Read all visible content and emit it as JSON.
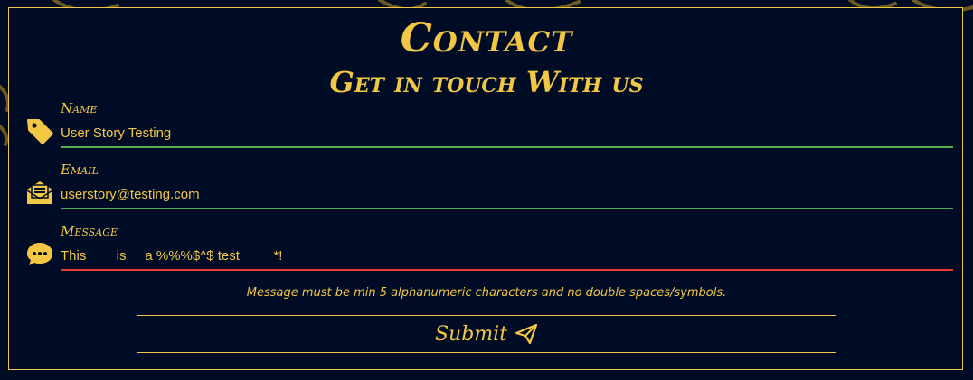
{
  "colors": {
    "background": "#000c26",
    "accent": "#f2c744",
    "valid_underline": "#4caf50",
    "invalid_underline": "#e53935"
  },
  "header": {
    "title": "Contact",
    "subtitle": "Get in touch With us"
  },
  "form": {
    "fields": [
      {
        "label": "Name",
        "icon": "tag-icon",
        "value": "User Story Testing",
        "status": "valid"
      },
      {
        "label": "Email",
        "icon": "envelope-open-icon",
        "value": "userstory@testing.com",
        "status": "valid"
      },
      {
        "label": "Message",
        "icon": "chat-bubble-icon",
        "value": "This        is     a %%%$^$ test         *!",
        "status": "invalid"
      }
    ],
    "error_message": "Message must be min 5 alphanumeric characters and no double spaces/symbols.",
    "submit_label": "Submit",
    "submit_icon": "paper-plane-icon"
  }
}
